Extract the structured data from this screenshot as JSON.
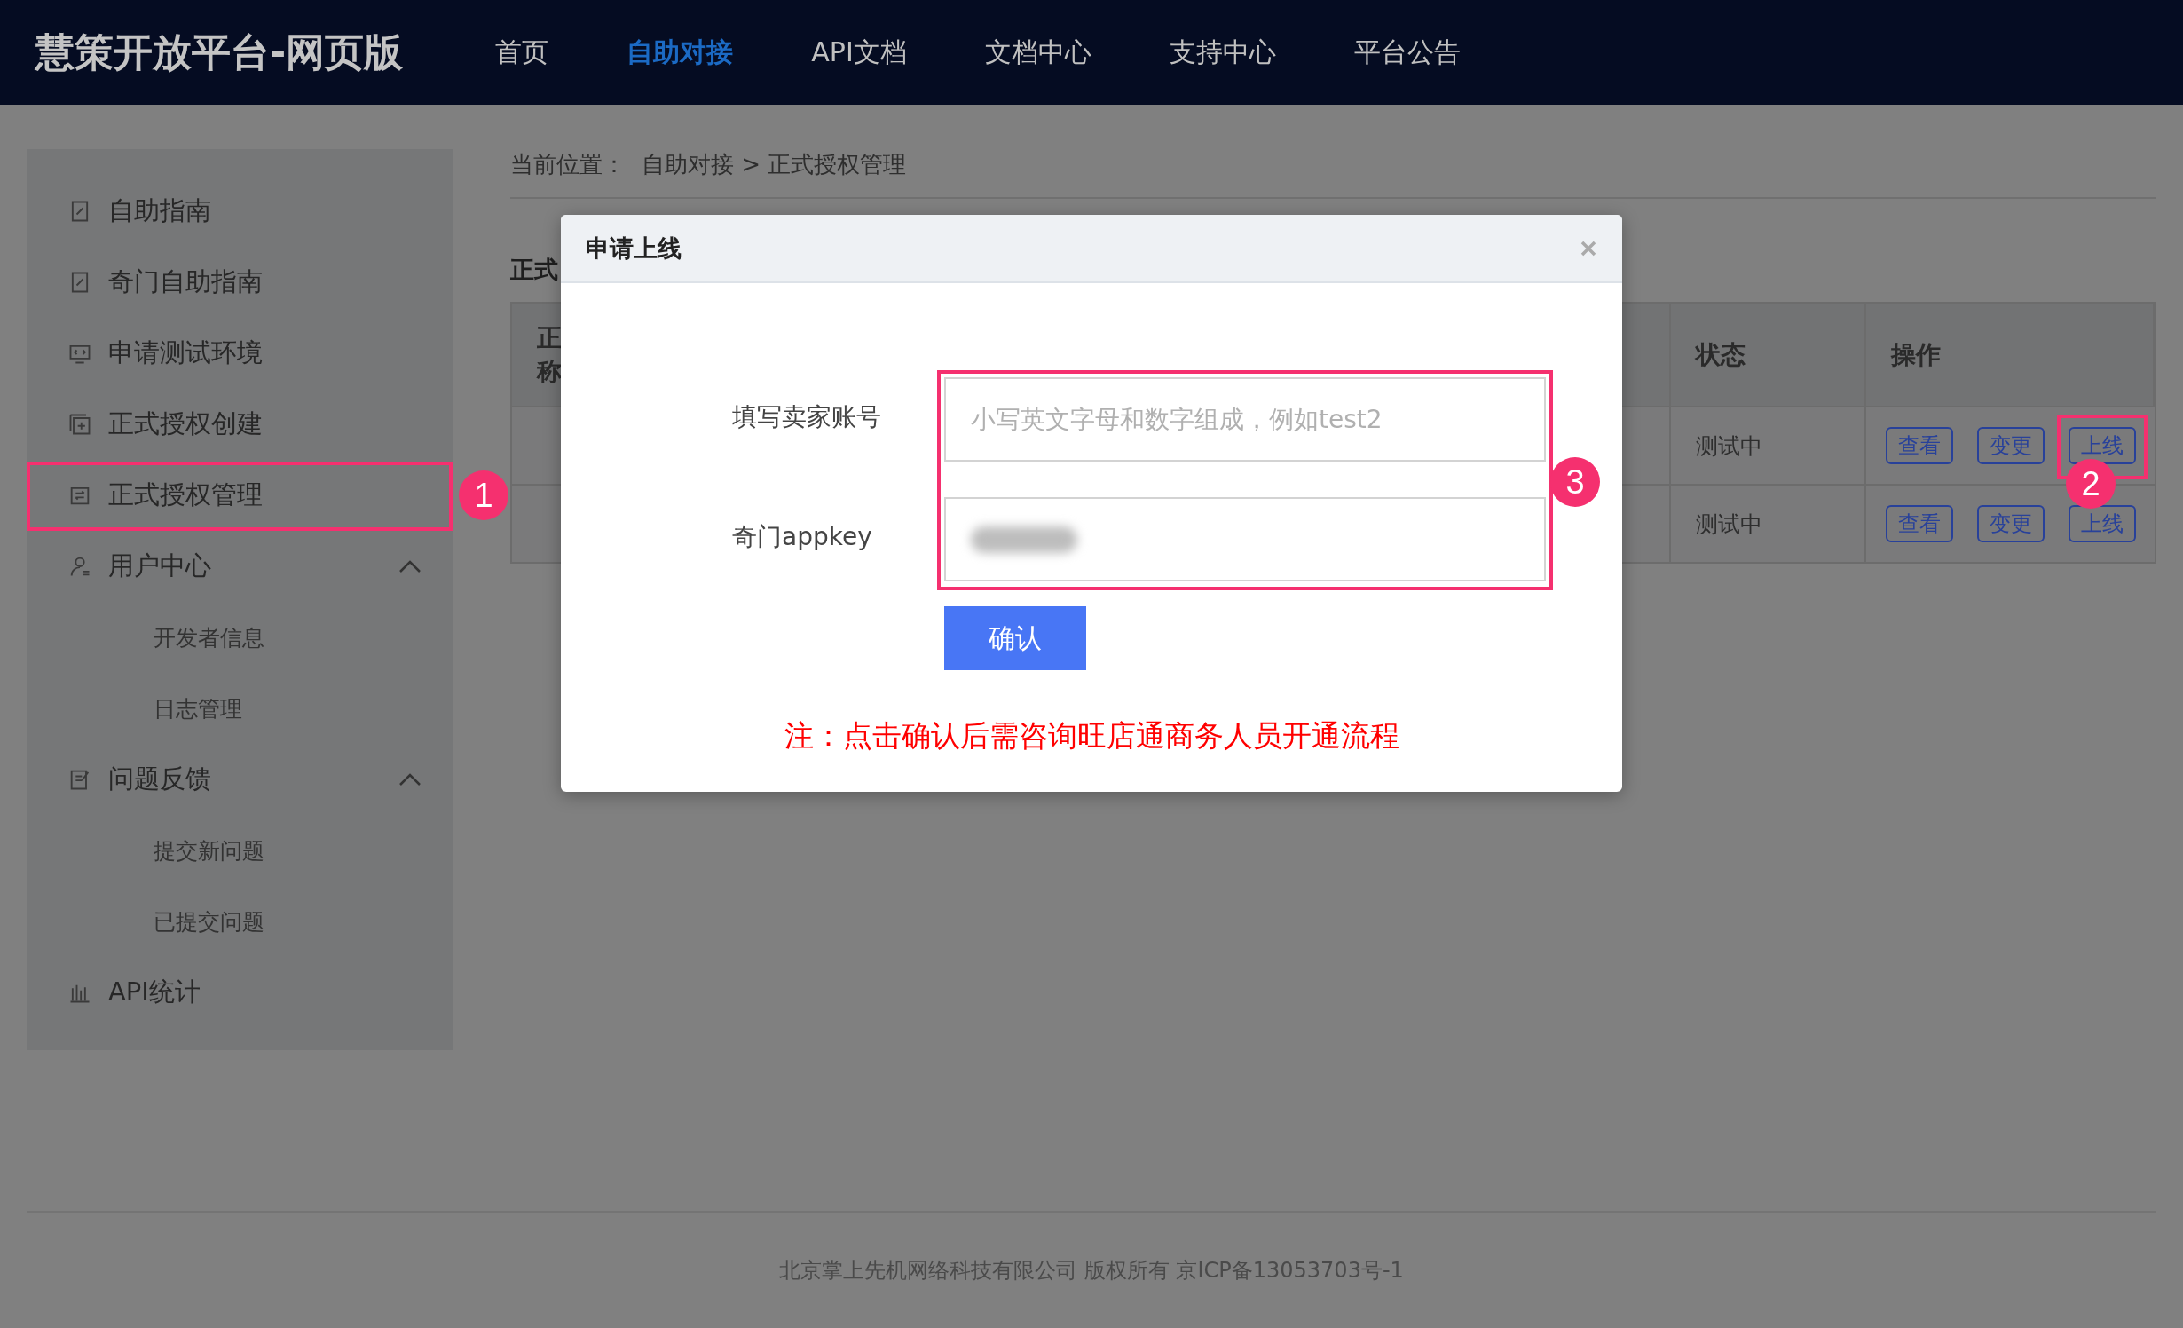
{
  "header": {
    "title": "慧策开放平台-网页版",
    "nav": [
      {
        "label": "首页",
        "selected": false
      },
      {
        "label": "自助对接",
        "selected": true
      },
      {
        "label": "API文档",
        "selected": false
      },
      {
        "label": "文档中心",
        "selected": false
      },
      {
        "label": "支持中心",
        "selected": false
      },
      {
        "label": "平台公告",
        "selected": false
      }
    ]
  },
  "sidebar": {
    "items": [
      {
        "label": "自助指南",
        "kind": "item"
      },
      {
        "label": "奇门自助指南",
        "kind": "item"
      },
      {
        "label": "申请测试环境",
        "kind": "item"
      },
      {
        "label": "正式授权创建",
        "kind": "item"
      },
      {
        "label": "正式授权管理",
        "kind": "item",
        "annotation": "1"
      },
      {
        "label": "用户中心",
        "kind": "group",
        "expanded": true,
        "children": [
          {
            "label": "开发者信息"
          },
          {
            "label": "日志管理"
          }
        ]
      },
      {
        "label": "问题反馈",
        "kind": "group",
        "expanded": true,
        "children": [
          {
            "label": "提交新问题"
          },
          {
            "label": "已提交问题"
          }
        ]
      },
      {
        "label": "API统计",
        "kind": "item"
      }
    ]
  },
  "breadcrumb": {
    "label": "当前位置：",
    "path": "自助对接 > 正式授权管理"
  },
  "section_title": "正式",
  "table": {
    "columns": [
      {
        "lines": [
          "正",
          "称"
        ]
      },
      {
        "label": "状态"
      },
      {
        "label": "操作"
      }
    ],
    "rows": [
      {
        "status": "测试中",
        "actions": [
          {
            "label": "查看"
          },
          {
            "label": "变更"
          },
          {
            "label": "上线",
            "annotation": "2"
          }
        ]
      },
      {
        "status": "测试中",
        "actions": [
          {
            "label": "查看"
          },
          {
            "label": "变更"
          },
          {
            "label": "上线"
          }
        ]
      }
    ]
  },
  "dialog": {
    "title": "申请上线",
    "annotation": "3",
    "fields": [
      {
        "label": "填写卖家账号",
        "placeholder": "小写英文字母和数字组成，例如test2",
        "redacted": false
      },
      {
        "label": "奇门appkey",
        "redacted": true
      }
    ],
    "confirm": "确认",
    "note": "注：点击确认后需咨询旺店通商务人员开通流程"
  },
  "footer": "北京掌上先机网络科技有限公司 版权所有 京ICP备13053703号-1"
}
